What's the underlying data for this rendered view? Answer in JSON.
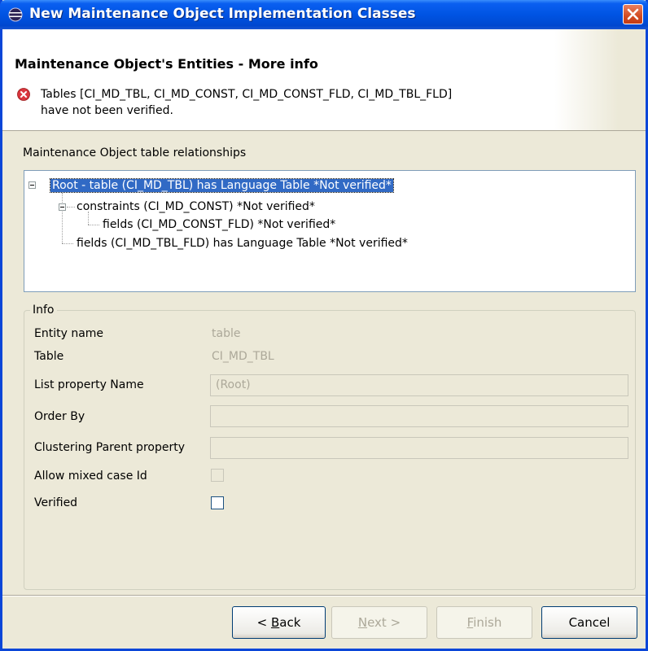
{
  "window": {
    "title": "New Maintenance Object Implementation Classes"
  },
  "header": {
    "title": "Maintenance Object's Entities - More info",
    "message_line1": "Tables [CI_MD_TBL, CI_MD_CONST, CI_MD_CONST_FLD, CI_MD_TBL_FLD]",
    "message_line2": "have not been verified."
  },
  "relationships": {
    "label": "Maintenance Object table relationships",
    "tree": [
      {
        "label": "Root - table   (CI_MD_TBL) has Language Table  *Not verified*",
        "selected": true
      },
      {
        "label": "constraints   (CI_MD_CONST) *Not verified*"
      },
      {
        "label": "fields   (CI_MD_CONST_FLD) *Not verified*"
      },
      {
        "label": "fields   (CI_MD_TBL_FLD) has Language Table  *Not verified*"
      }
    ]
  },
  "info": {
    "group_title": "Info",
    "entity_name_label": "Entity name",
    "entity_name_value": "table",
    "table_label": "Table",
    "table_value": "CI_MD_TBL",
    "list_property_label": "List property Name",
    "list_property_value": "(Root)",
    "order_by_label": "Order By",
    "order_by_value": "",
    "clustering_label": "Clustering Parent property",
    "clustering_value": "",
    "mixed_case_label": "Allow mixed case Id",
    "mixed_case_checked": false,
    "verified_label": "Verified",
    "verified_checked": false
  },
  "buttons": {
    "back_prefix": "< ",
    "back_mnemonic": "B",
    "back_rest": "ack",
    "next_mnemonic": "N",
    "next_rest": "ext >",
    "finish_mnemonic": "F",
    "finish_rest": "inish",
    "cancel": "Cancel"
  }
}
